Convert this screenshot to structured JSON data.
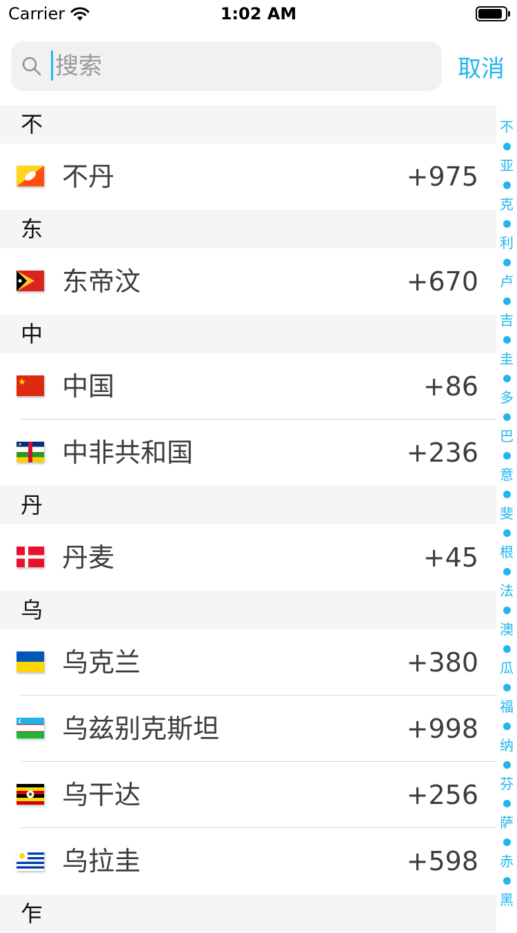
{
  "status_bar": {
    "carrier": "Carrier",
    "time": "1:02 AM",
    "battery_level": 0.9
  },
  "search": {
    "placeholder": "搜索",
    "value": "",
    "cancel_label": "取消"
  },
  "sections": [
    {
      "header": "不",
      "rows": [
        {
          "name": "不丹",
          "code": "+975",
          "flag": "flag-bhutan-icon"
        }
      ]
    },
    {
      "header": "东",
      "rows": [
        {
          "name": "东帝汶",
          "code": "+670",
          "flag": "flag-east-timor-icon"
        }
      ]
    },
    {
      "header": "中",
      "rows": [
        {
          "name": "中国",
          "code": "+86",
          "flag": "flag-china-icon"
        },
        {
          "name": "中非共和国",
          "code": "+236",
          "flag": "flag-central-african-republic-icon"
        }
      ]
    },
    {
      "header": "丹",
      "rows": [
        {
          "name": "丹麦",
          "code": "+45",
          "flag": "flag-denmark-icon"
        }
      ]
    },
    {
      "header": "乌",
      "rows": [
        {
          "name": "乌克兰",
          "code": "+380",
          "flag": "flag-ukraine-icon"
        },
        {
          "name": "乌兹别克斯坦",
          "code": "+998",
          "flag": "flag-uzbekistan-icon"
        },
        {
          "name": "乌干达",
          "code": "+256",
          "flag": "flag-uganda-icon"
        },
        {
          "name": "乌拉圭",
          "code": "+598",
          "flag": "flag-uruguay-icon"
        }
      ]
    },
    {
      "header": "乍",
      "rows": []
    }
  ],
  "index_bar": [
    "不",
    "亚",
    "克",
    "利",
    "卢",
    "吉",
    "圭",
    "多",
    "巴",
    "意",
    "斐",
    "根",
    "法",
    "澳",
    "瓜",
    "福",
    "纳",
    "芬",
    "萨",
    "赤",
    "黑"
  ],
  "colors": {
    "accent": "#1fb6ee",
    "section_bg": "#f5f5f5",
    "search_bg": "#f1f1f1"
  }
}
